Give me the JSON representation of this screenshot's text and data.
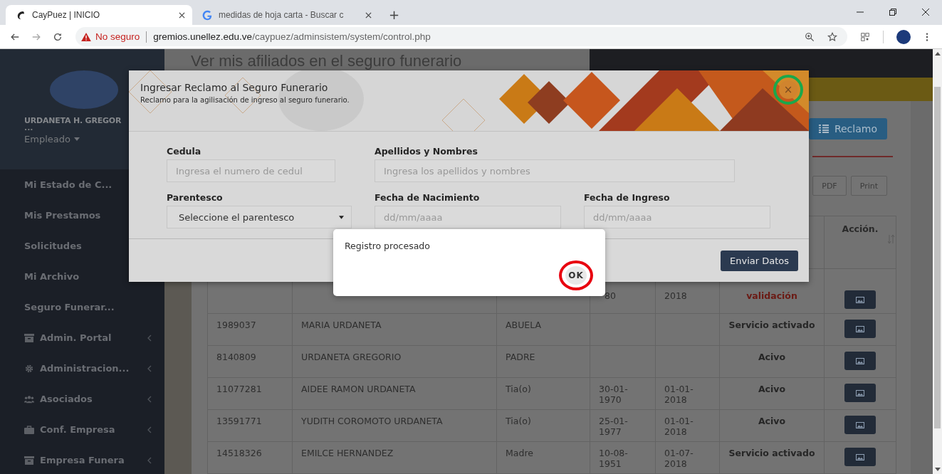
{
  "browser": {
    "tabs": [
      {
        "title": "CayPuez | INICIO",
        "selected": true,
        "kind": "site"
      },
      {
        "title": "medidas de hoja carta - Buscar c",
        "selected": false,
        "kind": "search"
      }
    ],
    "new_tab": "+",
    "address": {
      "security": "No seguro",
      "host": "gremios.unellez.edu.ve",
      "path": "/caypuez/adminsistem/system/control.php"
    }
  },
  "sidebar": {
    "user": {
      "name": "URDANETA H. GREGOR",
      "more": "...",
      "role": "Empleado"
    },
    "items": [
      {
        "label": "Mi Estado de C...",
        "kind": "link"
      },
      {
        "label": "Mis Prestamos",
        "kind": "link"
      },
      {
        "label": "Solicitudes",
        "kind": "link"
      },
      {
        "label": "Mi Archivo",
        "kind": "link"
      },
      {
        "label": "Seguro Funerar...",
        "kind": "link"
      },
      {
        "label": "Admin. Portal",
        "kind": "group"
      },
      {
        "label": "Administracion...",
        "kind": "group"
      },
      {
        "label": "Asociados",
        "kind": "group"
      },
      {
        "label": "Conf. Empresa",
        "kind": "group"
      },
      {
        "label": "Empresa Funera",
        "kind": "group"
      }
    ]
  },
  "page": {
    "heading": "Ver mis afiliados en el seguro funerario",
    "reclamo_button": "Reclamo",
    "export_buttons": [
      "PDF",
      "Print"
    ],
    "table": {
      "action_column": "Acción.",
      "rows": [
        {
          "nacimiento": "80",
          "ingreso": "2018",
          "estado": "validación",
          "pending": true
        },
        {
          "cedula": "1989037",
          "nombre": "MARIA URDANETA",
          "parentesco": "ABUELA",
          "estado": "Servicio activado",
          "pending": false
        },
        {
          "cedula": "8140809",
          "nombre": "URDANETA GREGORIO",
          "parentesco": "PADRE",
          "estado": "Acivo",
          "pending": false
        },
        {
          "cedula": "11077281",
          "nombre": "AIDEE RAMON URDANETA",
          "parentesco": "Tia(o)",
          "nacimiento": "30-01-1970",
          "ingreso": "01-01-2018",
          "estado": "Acivo",
          "pending": false
        },
        {
          "cedula": "13591771",
          "nombre": "YUDITH COROMOTO URDANETA",
          "parentesco": "Tia(o)",
          "nacimiento": "25-01-1977",
          "ingreso": "01-01-2018",
          "estado": "Acivo",
          "pending": false
        },
        {
          "cedula": "14518326",
          "nombre": "EMILCE HERNANDEZ",
          "parentesco": "Madre",
          "nacimiento": "10-08-1951",
          "ingreso": "01-07-2018",
          "estado": "Servicio activado",
          "pending": false
        }
      ]
    }
  },
  "modal": {
    "title": "Ingresar Reclamo al Seguro Funerario",
    "subtitle": "Reclamo para la agilisación de ingreso al seguro funerario.",
    "close_button": {
      "label": "×",
      "highlight": {
        "color": "#1aa84b"
      }
    },
    "fields": [
      {
        "label": "Cedula",
        "placeholder": "Ingresa el numero de cedul",
        "kind": "text"
      },
      {
        "label": "Apellidos y Nombres",
        "placeholder": "Ingresa los apellidos y nombres",
        "kind": "wide"
      },
      {
        "label": "Parentesco",
        "value": "Seleccione el parentesco",
        "kind": "select"
      },
      {
        "label": "Fecha de Nacimiento",
        "placeholder": "dd/mm/aaaa",
        "kind": "text"
      },
      {
        "label": "Fecha de Ingreso",
        "placeholder": "dd/mm/aaaa",
        "kind": "text"
      }
    ],
    "submit": "Enviar Datos"
  },
  "dialog": {
    "message": "Registro procesado",
    "ok_button": {
      "label": "OK",
      "highlight": {
        "color": "#e8000f"
      }
    }
  }
}
